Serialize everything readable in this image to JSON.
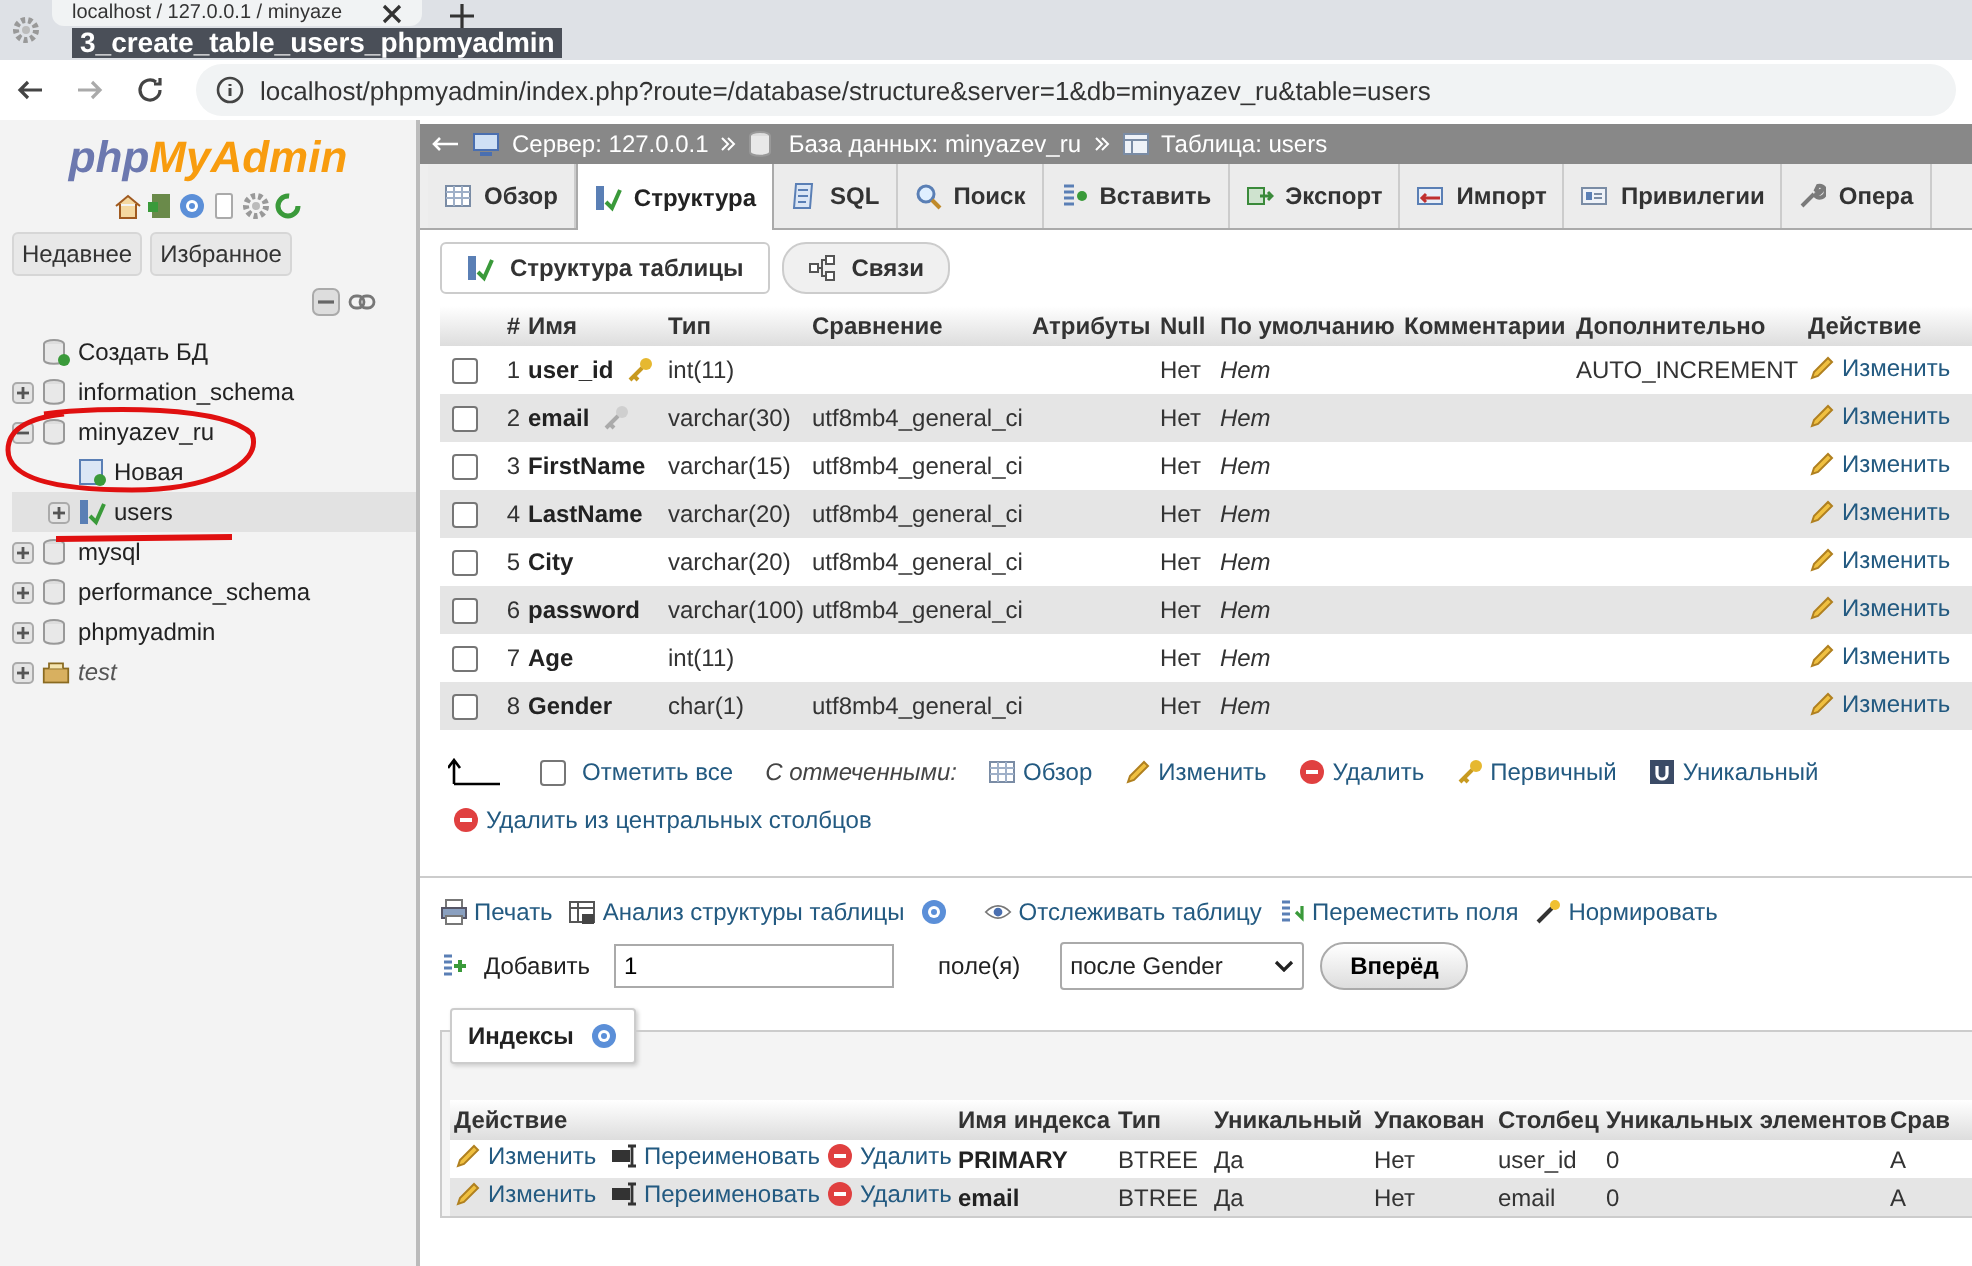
{
  "browser": {
    "tab_title": "localhost / 127.0.0.1 / minyaze",
    "overlay_title": "3_create_table_users_phpmyadmin",
    "url": "localhost/phpmyadmin/index.php?route=/database/structure&server=1&db=minyazev_ru&table=users"
  },
  "sidebar": {
    "logo": [
      "php",
      "MyAdmin"
    ],
    "buttons": [
      "Недавнее",
      "Избранное"
    ],
    "tree": [
      {
        "label": "Создать БД",
        "kind": "new"
      },
      {
        "label": "information_schema",
        "kind": "db",
        "expanded": false
      },
      {
        "label": "minyazev_ru",
        "kind": "db",
        "expanded": true,
        "children": [
          {
            "label": "Новая",
            "kind": "new"
          },
          {
            "label": "users",
            "kind": "table",
            "expanded": false,
            "selected": true
          }
        ]
      },
      {
        "label": "mysql",
        "kind": "db",
        "expanded": false
      },
      {
        "label": "performance_schema",
        "kind": "db",
        "expanded": false
      },
      {
        "label": "phpmyadmin",
        "kind": "db",
        "expanded": false
      },
      {
        "label": "test",
        "kind": "folder",
        "expanded": false
      }
    ]
  },
  "breadcrumb": [
    {
      "label": "Сервер: 127.0.0.1",
      "kind": "server"
    },
    {
      "label": "База данных: minyazev_ru",
      "kind": "database"
    },
    {
      "label": "Таблица: users",
      "kind": "table"
    }
  ],
  "tabs": [
    {
      "label": "Обзор",
      "kind": "browse",
      "selected": false
    },
    {
      "label": "Структура",
      "kind": "structure",
      "selected": true
    },
    {
      "label": "SQL",
      "kind": "sql",
      "selected": false
    },
    {
      "label": "Поиск",
      "kind": "search",
      "selected": false
    },
    {
      "label": "Вставить",
      "kind": "insert",
      "selected": false
    },
    {
      "label": "Экспорт",
      "kind": "export",
      "selected": false
    },
    {
      "label": "Импорт",
      "kind": "import",
      "selected": false
    },
    {
      "label": "Привилегии",
      "kind": "privileges",
      "selected": false
    },
    {
      "label": "Опера",
      "kind": "wrench",
      "selected": false
    }
  ],
  "subtabs": [
    {
      "label": "Структура таблицы",
      "kind": "structure",
      "selected": true
    },
    {
      "label": "Связи",
      "kind": "relations",
      "selected": false
    }
  ],
  "table": {
    "columns": [
      "#",
      "Имя",
      "Тип",
      "Сравнение",
      "Атрибуты",
      "Null",
      "По умолчанию",
      "Комментарии",
      "Дополнительно",
      "Действие"
    ],
    "rows": [
      {
        "num": "1",
        "name": "user_id",
        "primary_key": true,
        "unique_key": false,
        "type": "int(11)",
        "collation": "",
        "null": "Нет",
        "default": "Нет",
        "extra": "AUTO_INCREMENT",
        "action": "Изменить",
        "checked": false
      },
      {
        "num": "2",
        "name": "email",
        "primary_key": false,
        "unique_key": true,
        "type": "varchar(30)",
        "collation": "utf8mb4_general_ci",
        "null": "Нет",
        "default": "Нет",
        "extra": "",
        "action": "Изменить",
        "checked": false
      },
      {
        "num": "3",
        "name": "FirstName",
        "primary_key": false,
        "unique_key": false,
        "type": "varchar(15)",
        "collation": "utf8mb4_general_ci",
        "null": "Нет",
        "default": "Нет",
        "extra": "",
        "action": "Изменить",
        "checked": false
      },
      {
        "num": "4",
        "name": "LastName",
        "primary_key": false,
        "unique_key": false,
        "type": "varchar(20)",
        "collation": "utf8mb4_general_ci",
        "null": "Нет",
        "default": "Нет",
        "extra": "",
        "action": "Изменить",
        "checked": false
      },
      {
        "num": "5",
        "name": "City",
        "primary_key": false,
        "unique_key": false,
        "type": "varchar(20)",
        "collation": "utf8mb4_general_ci",
        "null": "Нет",
        "default": "Нет",
        "extra": "",
        "action": "Изменить",
        "checked": false
      },
      {
        "num": "6",
        "name": "password",
        "primary_key": false,
        "unique_key": false,
        "type": "varchar(100)",
        "collation": "utf8mb4_general_ci",
        "null": "Нет",
        "default": "Нет",
        "extra": "",
        "action": "Изменить",
        "checked": false
      },
      {
        "num": "7",
        "name": "Age",
        "primary_key": false,
        "unique_key": false,
        "type": "int(11)",
        "collation": "",
        "null": "Нет",
        "default": "Нет",
        "extra": "",
        "action": "Изменить",
        "checked": false
      },
      {
        "num": "8",
        "name": "Gender",
        "primary_key": false,
        "unique_key": false,
        "type": "char(1)",
        "collation": "utf8mb4_general_ci",
        "null": "Нет",
        "default": "Нет",
        "extra": "",
        "action": "Изменить",
        "checked": false
      }
    ]
  },
  "bulk": {
    "check_all": "Отметить все",
    "checked": false,
    "with_selected": "С отмеченными:",
    "actions": [
      {
        "label": "Обзор",
        "kind": "browse"
      },
      {
        "label": "Изменить",
        "kind": "edit"
      },
      {
        "label": "Удалить",
        "kind": "delete"
      },
      {
        "label": "Первичный",
        "kind": "primary"
      },
      {
        "label": "Уникальный",
        "kind": "unique"
      }
    ],
    "remove_central": "Удалить из центральных столбцов"
  },
  "links": [
    {
      "label": "Печать",
      "kind": "print"
    },
    {
      "label": "Анализ структуры таблицы",
      "kind": "analysis",
      "help": true
    },
    {
      "label": "Отслеживать таблицу",
      "kind": "track"
    },
    {
      "label": "Переместить поля",
      "kind": "move"
    },
    {
      "label": "Нормировать",
      "kind": "normalize"
    }
  ],
  "add": {
    "label": "Добавить",
    "value": "1",
    "unit": "поле(я)",
    "position": "после Gender",
    "button": "Вперёд"
  },
  "indexes": {
    "legend": "Индексы",
    "columns": [
      "Действие",
      "Имя индекса",
      "Тип",
      "Уникальный",
      "Упакован",
      "Столбец",
      "Уникальных элементов",
      "Срав"
    ],
    "rows": [
      {
        "edit": "Изменить",
        "rename": "Переименовать",
        "delete": "Удалить",
        "name": "PRIMARY",
        "type": "BTREE",
        "unique": "Да",
        "packed": "Нет",
        "column": "user_id",
        "cardinality": "0",
        "collation": "A"
      },
      {
        "edit": "Изменить",
        "rename": "Переименовать",
        "delete": "Удалить",
        "name": "email",
        "type": "BTREE",
        "unique": "Да",
        "packed": "Нет",
        "column": "email",
        "cardinality": "0",
        "collation": "A"
      }
    ]
  }
}
